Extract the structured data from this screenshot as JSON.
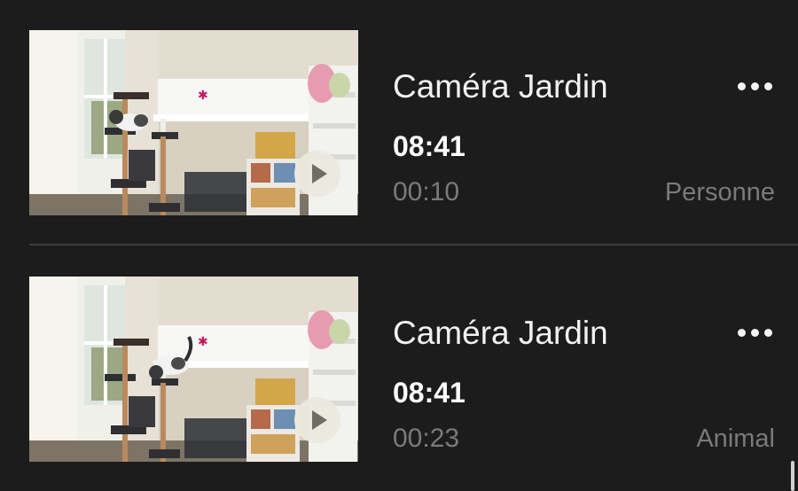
{
  "clips": [
    {
      "camera_name": "Caméra Jardin",
      "time": "08:41",
      "duration": "00:10",
      "tag": "Personne",
      "thumbnail_icon": "video-thumbnail",
      "play_icon": "play-icon",
      "more_icon": "more-options-icon"
    },
    {
      "camera_name": "Caméra Jardin",
      "time": "08:41",
      "duration": "00:23",
      "tag": "Animal",
      "thumbnail_icon": "video-thumbnail",
      "play_icon": "play-icon",
      "more_icon": "more-options-icon"
    }
  ],
  "colors": {
    "background": "#1c1c1c",
    "primary_text": "#f1f1f1",
    "secondary_text": "#7a7a7a",
    "divider": "#3e3e3e"
  }
}
